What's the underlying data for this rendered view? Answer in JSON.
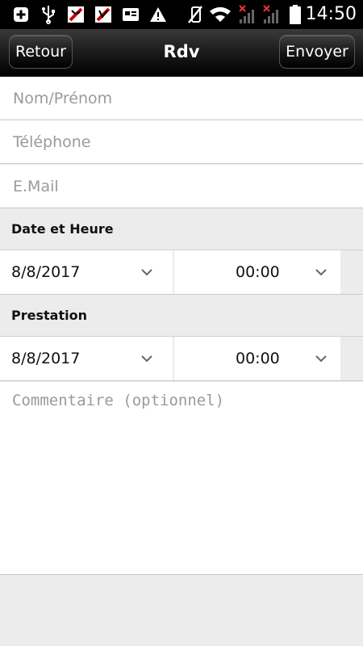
{
  "status_bar": {
    "time": "14:50",
    "icons": [
      "plus-icon",
      "usb-icon",
      "blocked-app-icon",
      "blocked-app-icon",
      "card-icon",
      "warning-icon",
      "mute-icon",
      "wifi-icon",
      "no-signal-icon",
      "no-signal-icon",
      "battery-icon"
    ]
  },
  "action_bar": {
    "back_label": "Retour",
    "title": "Rdv",
    "send_label": "Envoyer"
  },
  "form": {
    "name_placeholder": "Nom/Prénom",
    "phone_placeholder": "Téléphone",
    "email_placeholder": "E.Mail",
    "section_date": "Date et Heure",
    "date1": "8/8/2017",
    "time1": "00:00",
    "section_prestation": "Prestation",
    "date2": "8/8/2017",
    "time2": "00:00",
    "comment_placeholder": "Commentaire (optionnel)"
  }
}
